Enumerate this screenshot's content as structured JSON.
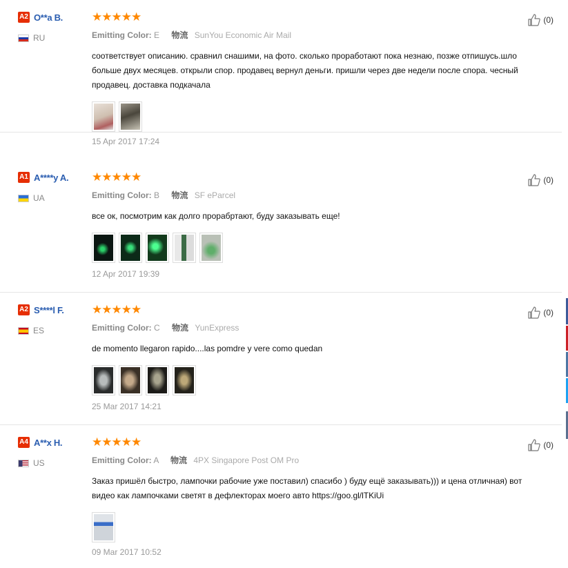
{
  "reviews": [
    {
      "level": "A2",
      "name": "O**a B.",
      "country": "RU",
      "flag": [
        "#ffffff",
        "#1c3aa9",
        "#d52b1e"
      ],
      "stars": "★★★★★",
      "color_label": "Emitting Color:",
      "color_value": "E",
      "logistics_label": "物流",
      "logistics": "SunYou Economic Air Mail",
      "feedback": "соответствует описанию. сравнил снашими, на фото. сколько проработают пока незнаю, позже отпишусь.шло больше двух месяцев. открыли спор. продавец вернул деньги. пришли через две недели после спора. чесный продавец. доставка подкачала",
      "photos": [
        "#d9c7b8",
        "#5e5a4a"
      ],
      "date": "15 Apr 2017 17:24",
      "helpful": "(0)"
    },
    {
      "level": "A1",
      "name": "A****y A.",
      "country": "UA",
      "flag": [
        "#2a6fd6",
        "#ffd500"
      ],
      "stars": "★★★★★",
      "color_label": "Emitting Color:",
      "color_value": "B",
      "logistics_label": "物流",
      "logistics": "SF eParcel",
      "feedback": "все ок, посмотрим как долго прорабртают, буду заказывать еще!",
      "photos": [
        "#0b1612",
        "#0c2a18",
        "#123a1c",
        "#7a7e78",
        "#9aa597"
      ],
      "date": "12 Apr 2017 19:39",
      "helpful": "(0)"
    },
    {
      "level": "A2",
      "name": "S****l F.",
      "country": "ES",
      "flag": [
        "#c60b1e",
        "#ffc400"
      ],
      "stars": "★★★★★",
      "color_label": "Emitting Color:",
      "color_value": "C",
      "logistics_label": "物流",
      "logistics": "YunExpress",
      "feedback": "de momento llegaron rapido....las pomdre y vere como quedan",
      "photos": [
        "#5b5f60",
        "#6b5a45",
        "#3b3a33",
        "#4a4536"
      ],
      "date": "25 Mar 2017 14:21",
      "helpful": "(0)"
    },
    {
      "level": "A4",
      "name": "A**x H.",
      "country": "US",
      "flag": [
        "#b22234",
        "#ffffff",
        "#3c3b6e"
      ],
      "stars": "★★★★★",
      "color_label": "Emitting Color:",
      "color_value": "A",
      "logistics_label": "物流",
      "logistics": "4PX Singapore Post OM Pro",
      "feedback": "Заказ пришёл быстро, лампочки рабочие уже поставил) спасибо ) буду ещё заказывать))) и цена отличная) вот видео как лампочками светят в дефлекторах моего авто https://goo.gl/lTKiUi",
      "photos": [
        "#8c9bb0"
      ],
      "date": "09 Mar 2017 10:52",
      "helpful": "(0)"
    }
  ],
  "icons": {
    "helpful": "thumbs-up-icon"
  },
  "colors": {
    "star": "#ff8800",
    "level_badge": "#e62e04",
    "buyer_name": "#2a5db0"
  }
}
